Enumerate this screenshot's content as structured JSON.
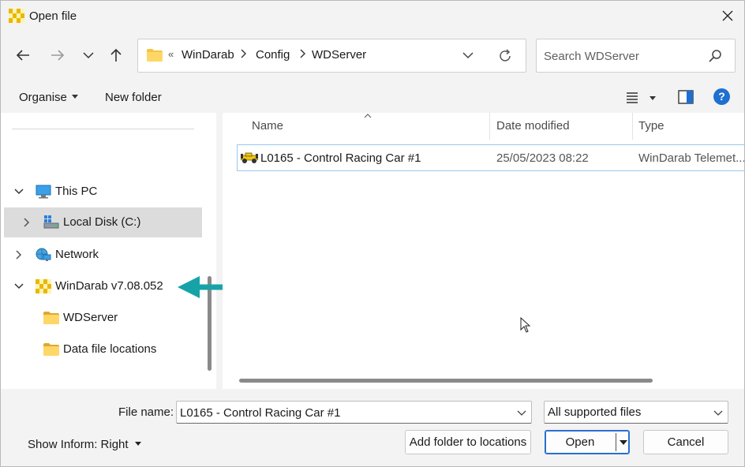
{
  "window": {
    "title": "Open file"
  },
  "address_bar": {
    "overflow_glyph": "«",
    "breadcrumbs": [
      "WinDarab",
      "Config",
      "WDServer"
    ]
  },
  "search": {
    "placeholder": "Search WDServer"
  },
  "toolbar": {
    "organise_label": "Organise",
    "new_folder_label": "New folder"
  },
  "nav_tree": {
    "items": [
      {
        "label": "This PC",
        "expanded": true,
        "icon": "computer-icon"
      },
      {
        "label": "Local Disk (C:)",
        "expanded": false,
        "selected": true,
        "icon": "drive-icon"
      },
      {
        "label": "Network",
        "expanded": false,
        "icon": "network-icon"
      },
      {
        "label": "WinDarab v7.08.052",
        "expanded": true,
        "icon": "windarab-icon"
      },
      {
        "label": "WDServer",
        "icon": "folder-icon"
      },
      {
        "label": "Data file locations",
        "icon": "folder-icon"
      }
    ]
  },
  "file_list": {
    "columns": [
      "Name",
      "Date modified",
      "Type"
    ],
    "rows": [
      {
        "name": "L0165 - Control Racing Car #1",
        "date_modified": "25/05/2023 08:22",
        "type": "WinDarab Telemet..."
      }
    ]
  },
  "bottom": {
    "file_name_label": "File name:",
    "file_name_value": "L0165 - Control Racing Car #1",
    "filter_value": "All supported files",
    "show_inform_label": "Show Inform: Right",
    "add_folder_label": "Add folder to locations",
    "open_label": "Open",
    "cancel_label": "Cancel"
  },
  "colors": {
    "accent": "#1f6fd1",
    "annotation_arrow": "#16a3a8",
    "selection_bg": "#dcdcdc",
    "folder": "#f5c542"
  }
}
